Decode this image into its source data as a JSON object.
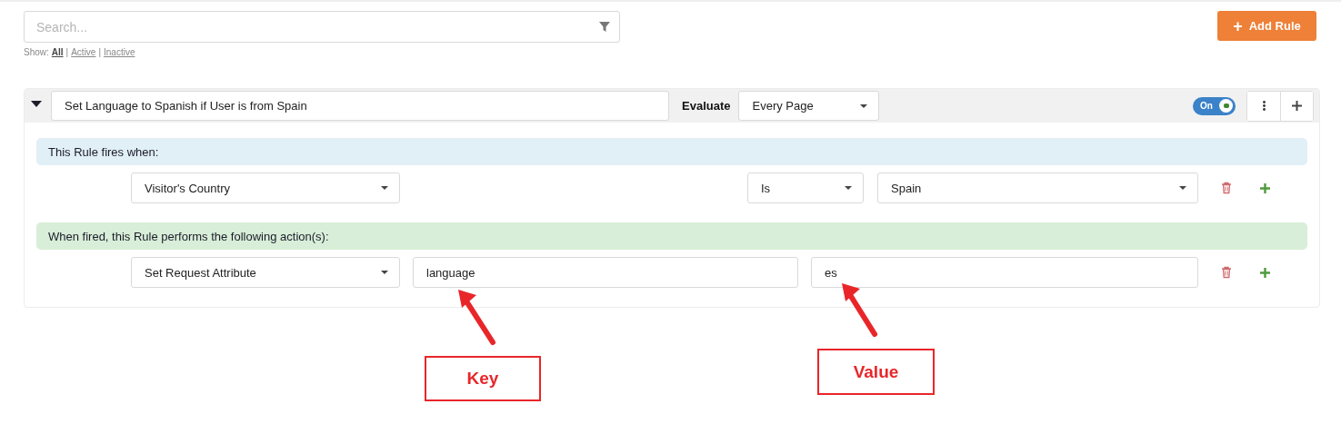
{
  "search": {
    "placeholder": "Search..."
  },
  "show_filter": {
    "label": "Show:",
    "separator": "|",
    "options": [
      {
        "label": "All",
        "selected": true
      },
      {
        "label": "Active",
        "selected": false
      },
      {
        "label": "Inactive",
        "selected": false
      }
    ]
  },
  "add_button": {
    "icon": "+",
    "label": "Add Rule"
  },
  "rule": {
    "expanded": true,
    "name": "Set Language to Spanish if User is from Spain",
    "evaluate_label": "Evaluate",
    "evaluate": "Every Page",
    "toggle": {
      "label": "On",
      "on": true
    },
    "conditions_heading": "This Rule fires when:",
    "conditions": [
      {
        "field": "Visitor's Country",
        "operator": "Is",
        "value": "Spain"
      }
    ],
    "actions_heading": "When fired, this Rule performs the following action(s):",
    "actions": [
      {
        "type": "Set Request Attribute",
        "key": "language",
        "value": "es"
      }
    ]
  },
  "annotations": [
    {
      "label": "Key"
    },
    {
      "label": "Value"
    }
  ]
}
